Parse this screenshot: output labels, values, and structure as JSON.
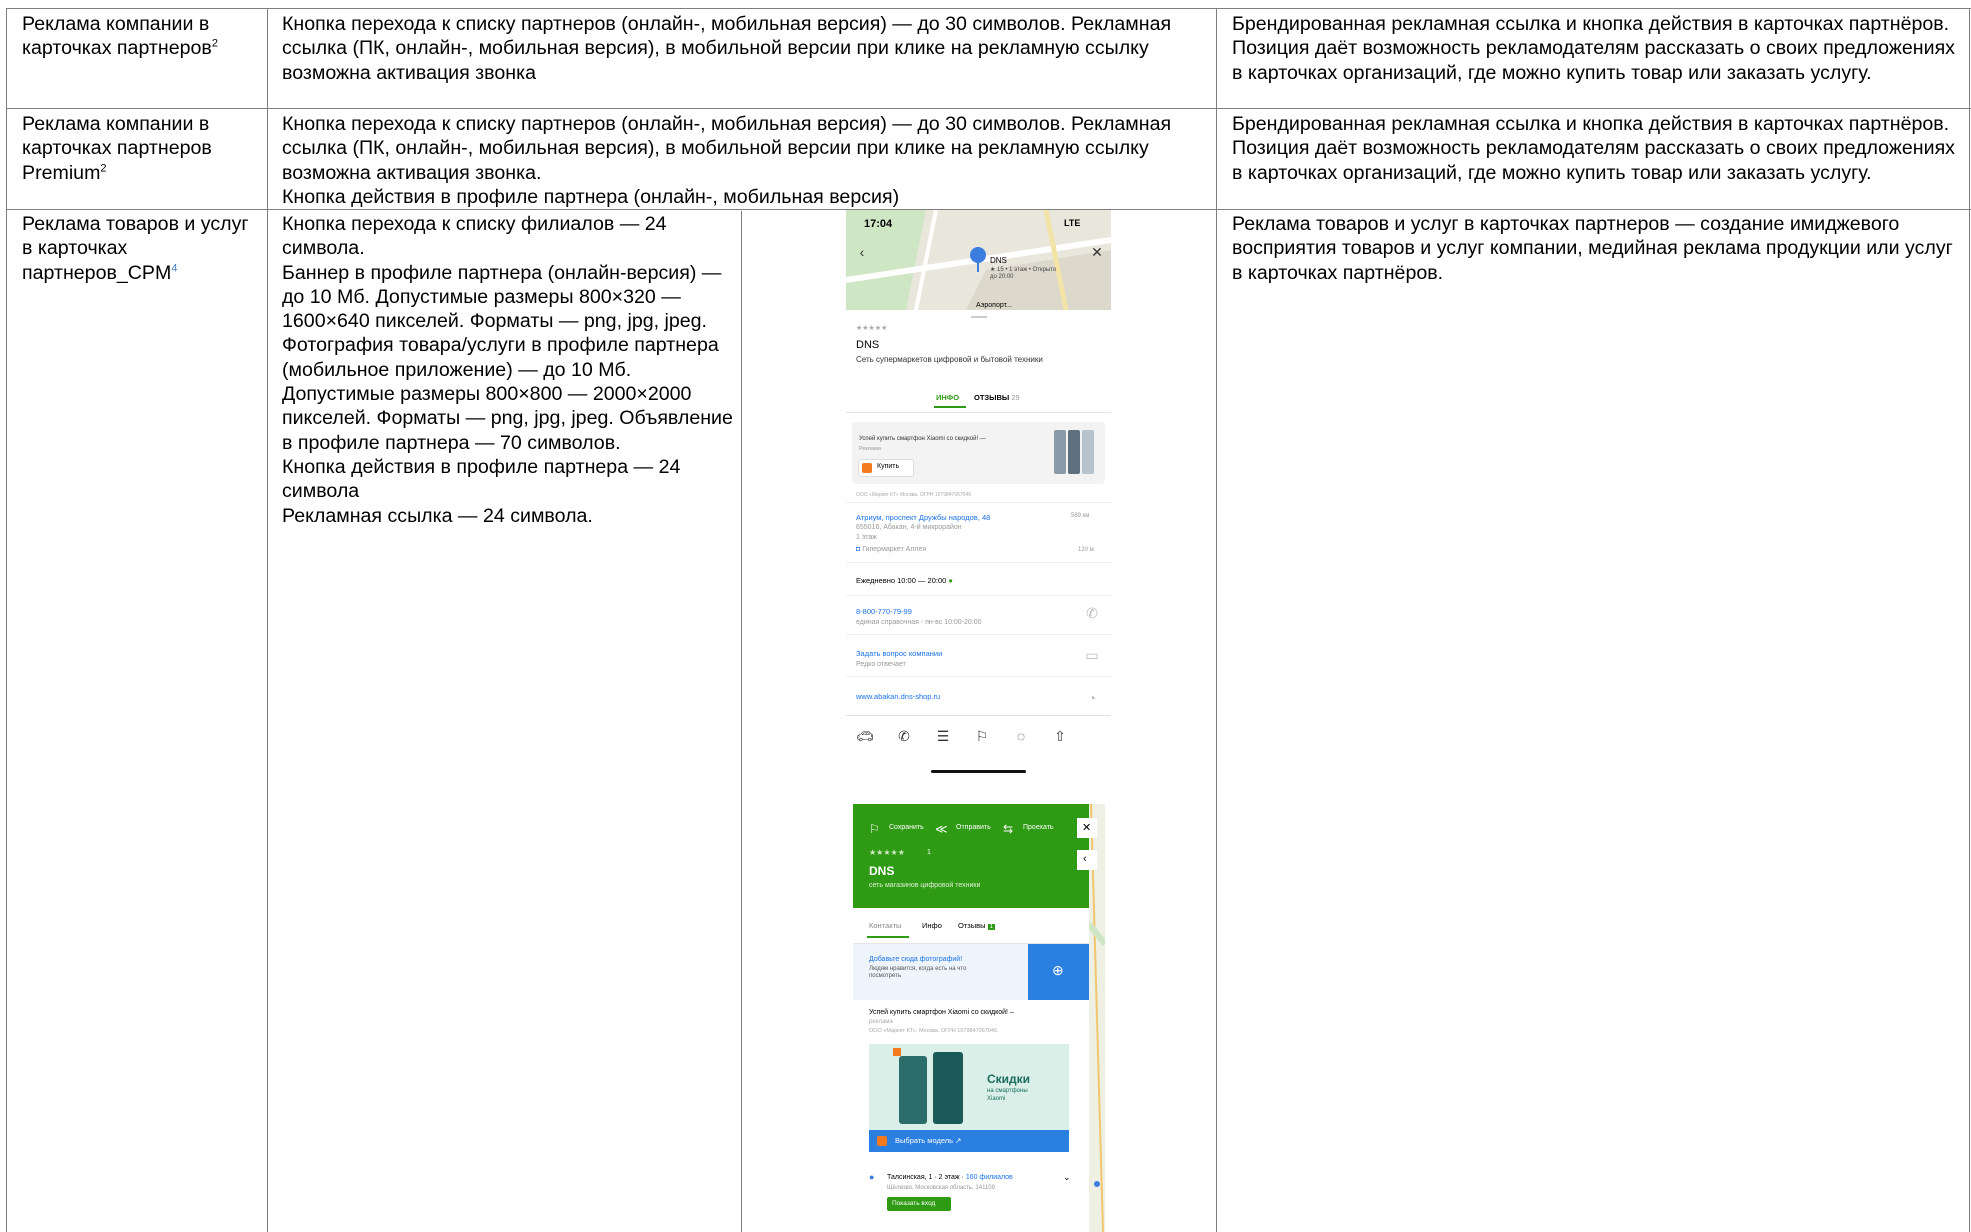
{
  "rows": [
    {
      "title": "Реклама компании в карточках партнеров",
      "title_sup": "2",
      "requirements": "Кнопка перехода к списку партнеров (онлайн-, мобильная версия) — до 30 символов. Рекламная ссылка (ПК, онлайн-, мобильная версия), в мобильной версии при клике на рекламную ссылку возможна активация звонка",
      "description": "Брендированная рекламная ссылка и кнопка действия в карточках партнёров. Позиция даёт возможность рекламодателям рассказать о своих предложениях в карточках организаций, где можно купить товар или заказать услугу."
    },
    {
      "title": "Реклама компании в карточках партнеров Premium",
      "title_sup": "2",
      "requirements": "Кнопка перехода к списку партнеров (онлайн-, мобильная версия) — до 30 символов. Рекламная ссылка (ПК, онлайн-, мобильная версия), в мобильной версии при клике на рекламную ссылку возможна активация звонка.\nКнопка действия в профиле партнера (онлайн-, мобильная версия)",
      "description": "Брендированная рекламная ссылка и кнопка действия в карточках партнёров. Позиция даёт возможность рекламодателям рассказать о своих предложениях в карточках организаций, где можно купить товар или заказать услугу."
    },
    {
      "title": "Реклама товаров и услуг в карточках партнеров_CPM",
      "title_sup": "4",
      "requirements": "Кнопка перехода к списку филиалов — 24 символа.\nБаннер в профиле партнера (онлайн-версия) — до 10 Мб. Допустимые размеры 800×320 — 1600×640 пикселей. Форматы — png, jpg, jpeg.\nФотография товара/услуги в профиле партнера (мобильное приложение) — до 10 Мб. Допустимые размеры 800×800 — 2000×2000 пикселей. Форматы — png, jpg, jpeg. Объявление в профиле партнера — 70 символов.\nКнопка действия в профиле партнера — 24 символа\nРекламная ссылка — 24 символа.",
      "description": "Реклама товаров и услуг в карточках партнеров — создание имиджевого восприятия товаров и услуг компании, медийная реклама продукции или услуг в карточках партнёров."
    }
  ],
  "mobile_screenshot": {
    "time": "17:04",
    "network": "LTE",
    "map_pin_label": "DNS",
    "map_pin_sub1": "★ 15 • 1 этаж • Открыто",
    "map_pin_sub2": "до 20:00",
    "map_street": "Аэропорт...",
    "rating_stars": "★★★★★",
    "company": "DNS",
    "company_desc": "Сеть супермаркетов цифровой и бытовой техники",
    "tab_info": "ИНФО",
    "tab_reviews": "ОТЗЫВЫ",
    "reviews_count": "29",
    "ad_text": "Успей купить смартфон Xiaomi со скидкой! —",
    "ad_sub": "Реклама",
    "buy_button": "Купить",
    "legal": "ООО «Маркет КТ» Москва. ОГРН 1079847067046",
    "address_link": "Атриум, проспект Дружбы народов, 48",
    "address_distance": "589 км",
    "address_line1": "655016, Абакан, 4-й микрорайон",
    "address_line2": "1 этаж",
    "landmark": "Гипермаркет Аллея",
    "landmark_distance": "120 м",
    "hours": "Ежедневно 10:00 — 20:00",
    "phone": "8-800-770-79-99",
    "phone_note": "единая справочная - пн-вс 10:00-20:00",
    "ask_link": "Задать вопрос компании",
    "ask_note": "Редко отвечает",
    "website": "www.abakan.dns-shop.ru",
    "bottom_icons": [
      "car-icon",
      "phone-icon",
      "menu-icon",
      "bookmark-icon",
      "chat-icon",
      "share-icon"
    ]
  },
  "web_screenshot": {
    "save": "Сохранить",
    "send": "Отправить",
    "route": "Проехать",
    "rating_stars": "★★★★★",
    "rating_count": "1",
    "company": "DNS",
    "company_desc": "сеть магазинов цифровой техники",
    "tab_contacts": "Контакты",
    "tab_info": "Инфо",
    "tab_reviews": "Отзывы",
    "reviews_count": "1",
    "photo_link": "Добавьте сюда фотографий!",
    "photo_note": "Людям нравится, когда есть на что посмотреть",
    "ad_text": "Успей купить смартфон Xiaomi со скидкой! –",
    "ad_sub": "реклама",
    "legal": "ООО «Маркет КТ». Москва. ОГРН 1079847067046.",
    "banner_title": "Скидки",
    "banner_sub1": "на смартфоны",
    "banner_sub2": "Xiaomi",
    "choose_button": "Выбрать модель ↗",
    "address": "Талсинская, 1 · 2 этаж ·",
    "branches_link": "160 филиалов",
    "address_city": "Щёлково, Московская область, 141109",
    "show_entrance": "Показать вход",
    "colors": {
      "header_green": "#2f9a14",
      "accent_blue": "#2a7fe0",
      "link_blue": "#1a73e8"
    }
  }
}
